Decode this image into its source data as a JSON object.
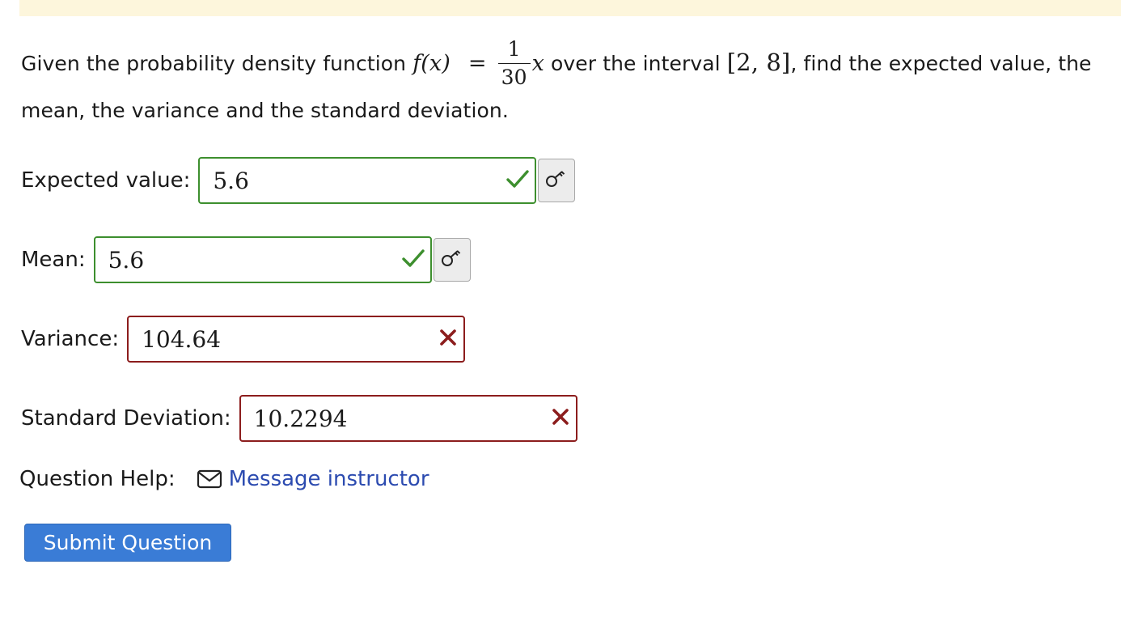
{
  "question": {
    "prefix": "Given the probability density function",
    "f_of_x": "f(x)",
    "equals": "=",
    "frac_num": "1",
    "frac_den": "30",
    "var": "x",
    "middle": "over the interval",
    "interval": "[2, 8]",
    "suffix": ", find the expected value, the mean, the variance and the standard deviation."
  },
  "answers": [
    {
      "label": "Expected value:",
      "value": "5.6",
      "status": "correct"
    },
    {
      "label": "Mean:",
      "value": "5.6",
      "status": "correct"
    },
    {
      "label": "Variance:",
      "value": "104.64",
      "status": "incorrect"
    },
    {
      "label": "Standard Deviation:",
      "value": "10.2294",
      "status": "incorrect"
    }
  ],
  "help": {
    "label": "Question Help:",
    "link": "Message instructor",
    "icon": "mail-icon"
  },
  "submit_label": "Submit Question",
  "colors": {
    "correct": "#3d8f2e",
    "incorrect": "#8c1d1d",
    "link": "#2c4bb0",
    "button": "#3a7cd6",
    "banner": "#fdf6dc"
  }
}
